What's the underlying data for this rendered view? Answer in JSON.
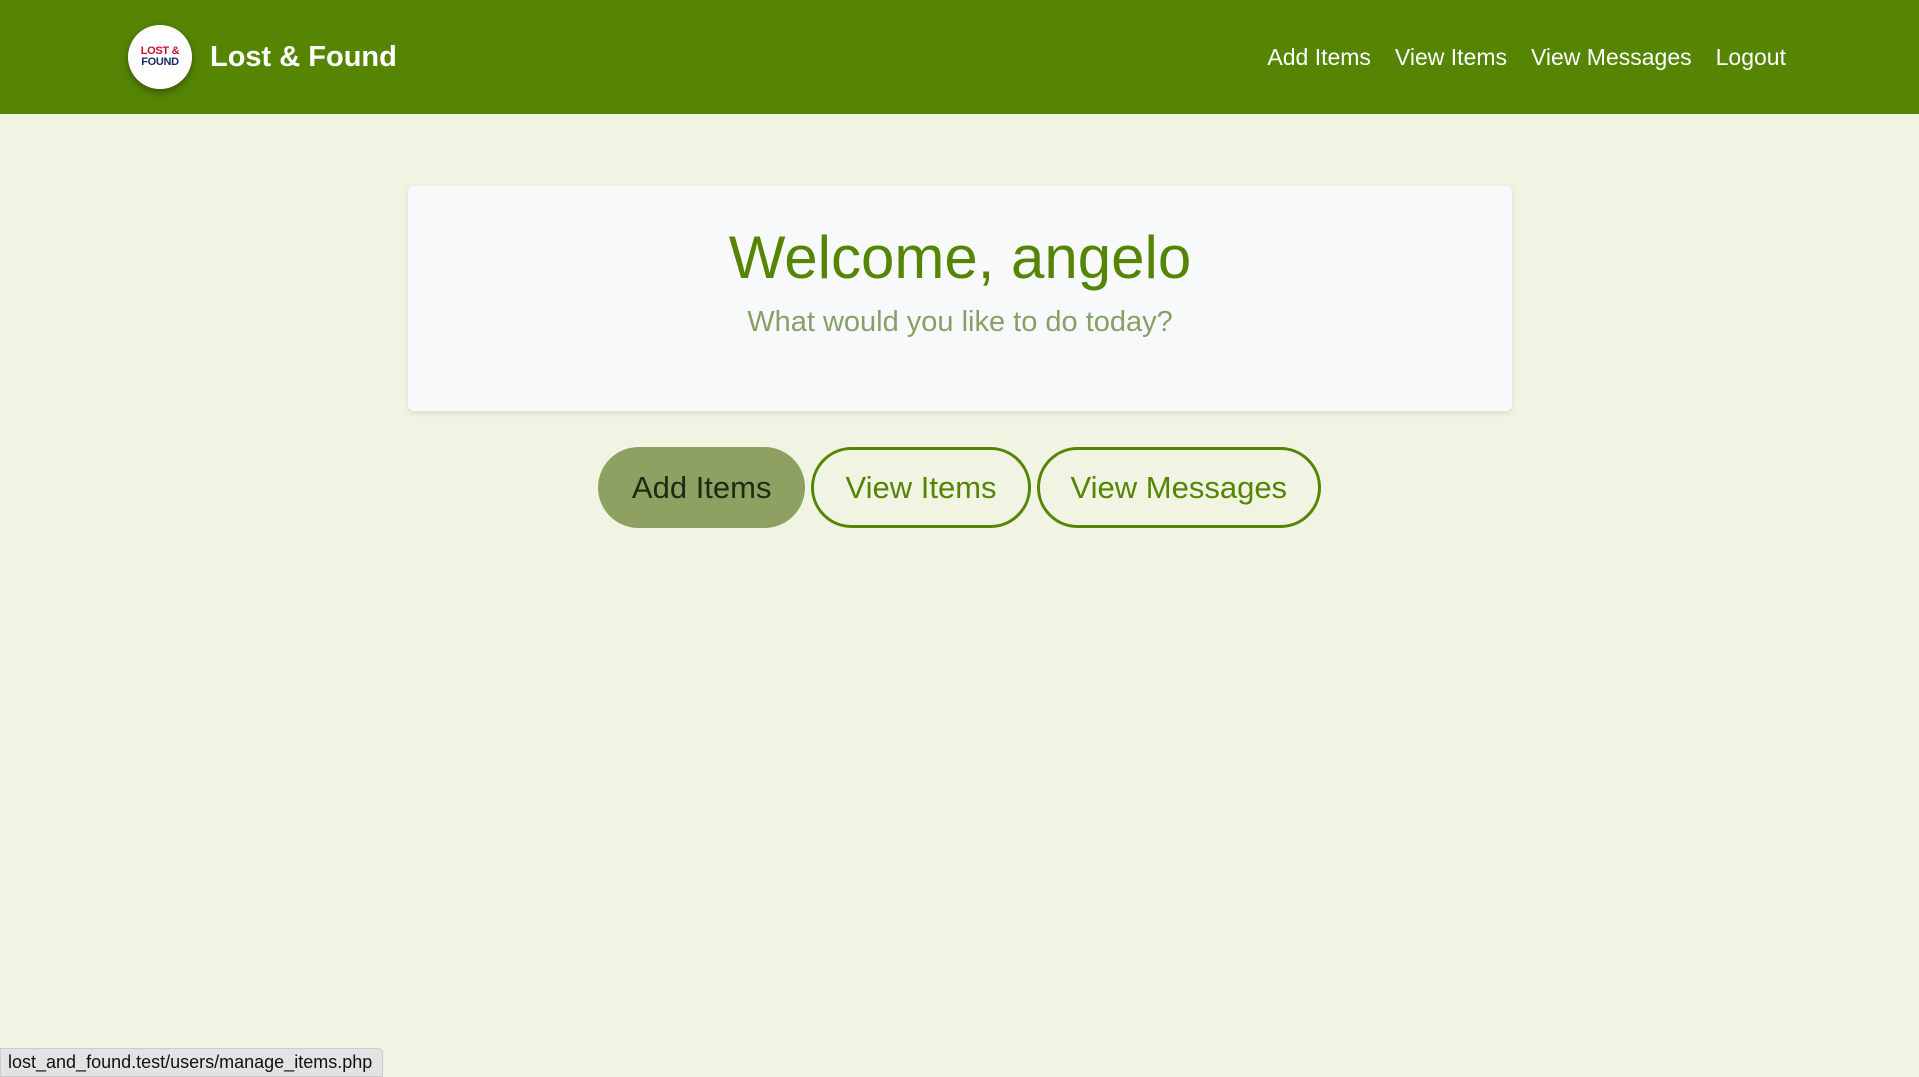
{
  "colors": {
    "accent": "#558503",
    "page_background": "#f1f4e2",
    "card_background": "#f8f9fa",
    "filled_button": "#8ea062",
    "subtitle": "#87a068"
  },
  "navbar": {
    "logo": {
      "icon": "lost-and-found-logo",
      "line1": "LOST &",
      "line2": "FOUND"
    },
    "brand_title": "Lost & Found",
    "links": [
      {
        "label": "Add Items"
      },
      {
        "label": "View Items"
      },
      {
        "label": "View Messages"
      },
      {
        "label": "Logout"
      }
    ]
  },
  "welcome": {
    "title": "Welcome, angelo",
    "subtitle": "What would you like to do today?"
  },
  "actions": [
    {
      "label": "Add Items",
      "style": "filled"
    },
    {
      "label": "View Items",
      "style": "outline"
    },
    {
      "label": "View Messages",
      "style": "outline"
    }
  ],
  "status_bar": {
    "url": "lost_and_found.test/users/manage_items.php"
  }
}
